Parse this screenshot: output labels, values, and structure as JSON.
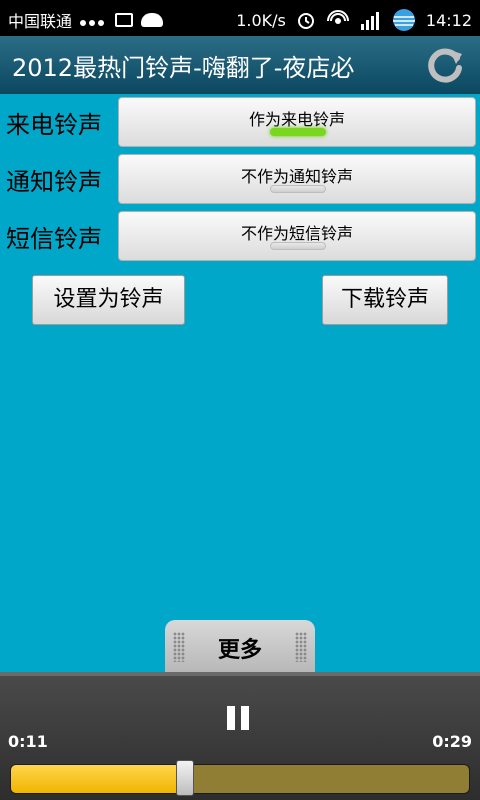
{
  "status_bar": {
    "carrier": "中国联通",
    "speed": "1.0K/s",
    "time": "14:12"
  },
  "title": "2012最热门铃声-嗨翻了-夜店必",
  "settings": [
    {
      "label": "来电铃声",
      "button_text": "作为来电铃声",
      "on": true
    },
    {
      "label": "通知铃声",
      "button_text": "不作为通知铃声",
      "on": false
    },
    {
      "label": "短信铃声",
      "button_text": "不作为短信铃声",
      "on": false
    }
  ],
  "actions": {
    "set_ringtone": "设置为铃声",
    "download_ringtone": "下载铃声"
  },
  "more_label": "更多",
  "player": {
    "elapsed": "0:11",
    "total": "0:29",
    "progress": 0.38
  },
  "colors": {
    "background": "#00a7c9",
    "toggle_on": "#7ad61e",
    "progress": "#f0b500"
  }
}
